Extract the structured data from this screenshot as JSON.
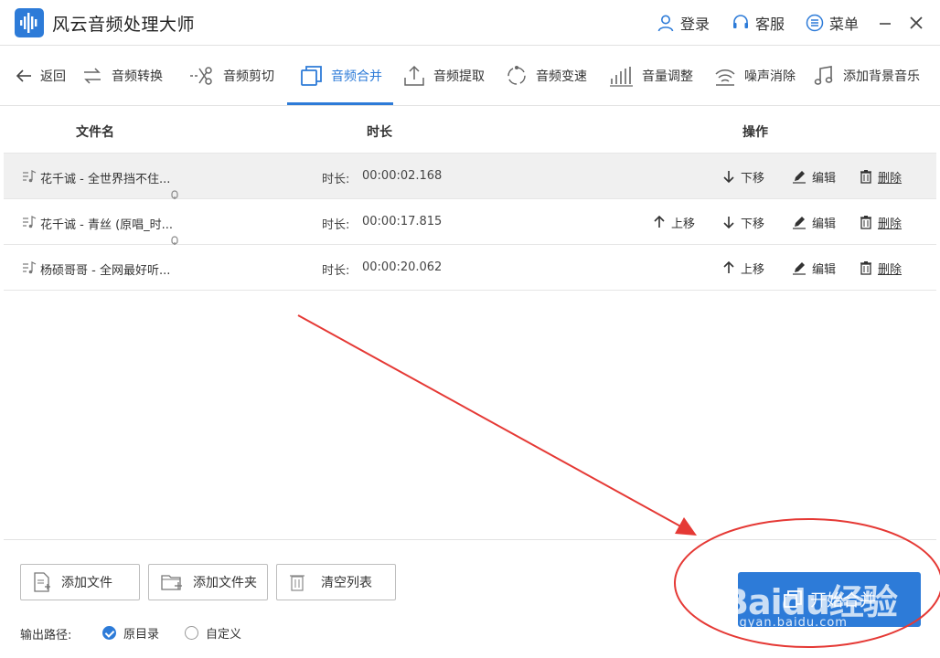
{
  "app": {
    "title": "风云音频处理大师"
  },
  "titlebar": {
    "login": "登录",
    "service": "客服",
    "menu": "菜单"
  },
  "toolbar": {
    "back": "返回",
    "items": [
      {
        "label": "音频转换"
      },
      {
        "label": "音频剪切"
      },
      {
        "label": "音频合并"
      },
      {
        "label": "音频提取"
      },
      {
        "label": "音频变速"
      },
      {
        "label": "音量调整"
      },
      {
        "label": "噪声消除"
      },
      {
        "label": "添加背景音乐"
      }
    ],
    "active_index": 2
  },
  "table": {
    "headers": {
      "filename": "文件名",
      "duration": "时长",
      "ops": "操作"
    },
    "duration_label": "时长:",
    "op_labels": {
      "up": "上移",
      "down": "下移",
      "edit": "编辑",
      "delete": "删除"
    },
    "rows": [
      {
        "name": "花千诚 - 全世界挡不住...",
        "duration": "00:00:02.168"
      },
      {
        "name": "花千诚 - 青丝 (原唱_时...",
        "duration": "00:00:17.815"
      },
      {
        "name": "杨硕哥哥 - 全网最好听...",
        "duration": "00:00:20.062"
      }
    ]
  },
  "bottom": {
    "add_file": "添加文件",
    "add_folder": "添加文件夹",
    "clear_list": "清空列表",
    "output_label": "输出路径:",
    "radio_original": "原目录",
    "radio_custom": "自定义",
    "start": "开始合并"
  },
  "watermark": {
    "brand": "Baidu经验",
    "url": "jingyan.baidu.com"
  },
  "colors": {
    "accent": "#2d7bd8",
    "annotation": "#e53935"
  }
}
